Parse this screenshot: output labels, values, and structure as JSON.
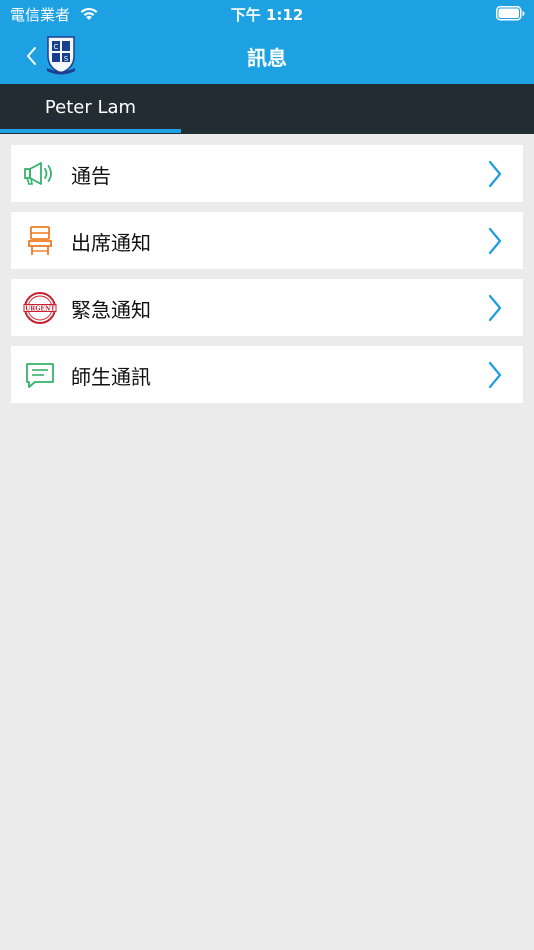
{
  "status": {
    "carrier": "電信業者",
    "time": "下午 1:12"
  },
  "nav": {
    "title": "訊息"
  },
  "tabs": [
    {
      "label": "Peter Lam",
      "selected": true
    }
  ],
  "menu": {
    "items": [
      {
        "label": "通告",
        "icon": "megaphone-icon"
      },
      {
        "label": "出席通知",
        "icon": "chair-icon"
      },
      {
        "label": "緊急通知",
        "icon": "urgent-stamp-icon",
        "stamp_text": "URGENT"
      },
      {
        "label": "師生通訊",
        "icon": "chat-bubble-icon"
      }
    ]
  },
  "colors": {
    "accent": "#1da1e3",
    "tab_bar": "#222c33",
    "background": "#ebebeb",
    "megaphone": "#33b36b",
    "chair": "#ef7d22",
    "urgent": "#c8202f",
    "chat": "#33b36b"
  }
}
